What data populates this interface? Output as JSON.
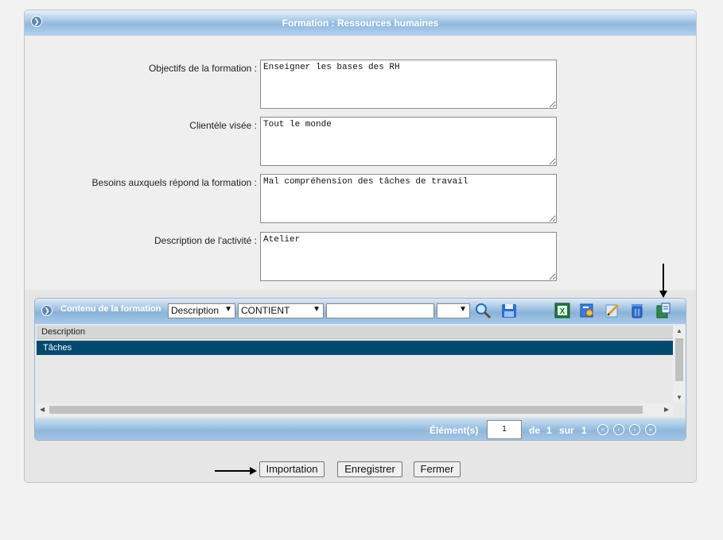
{
  "panel": {
    "title": "Formation : Ressources humaines"
  },
  "form": {
    "fields": [
      {
        "label": "Objectifs de la formation :",
        "value": "Enseigner les bases des RH"
      },
      {
        "label": "Clientèle visée :",
        "value": "Tout le monde"
      },
      {
        "label": "Besoins auxquels répond la formation :",
        "value": "Mal compréhension des tâches de travail"
      },
      {
        "label": "Description de l'activité :",
        "value": "Atelier"
      }
    ]
  },
  "grid": {
    "title": "Contenu de la formation",
    "field_select": "Description",
    "operator_select": "CONTIENT",
    "search_value": "",
    "extra_select": "",
    "tool_icons": [
      "search-icon",
      "save-icon",
      "excel-export-icon",
      "key-icon",
      "edit-icon",
      "trash-icon",
      "import-icon"
    ],
    "columns": [
      "Description"
    ],
    "rows": [
      {
        "description": "Tâches",
        "selected": true
      }
    ],
    "pager": {
      "elements_label": "Élément(s)",
      "page": "1",
      "of_label": "de",
      "current": "1",
      "sur_label": "sur",
      "total": "1"
    }
  },
  "buttons": {
    "import": "Importation",
    "save": "Enregistrer",
    "close": "Fermer"
  },
  "colors": {
    "header_blue": "#8fb9df",
    "selected_row": "#004a6e"
  }
}
